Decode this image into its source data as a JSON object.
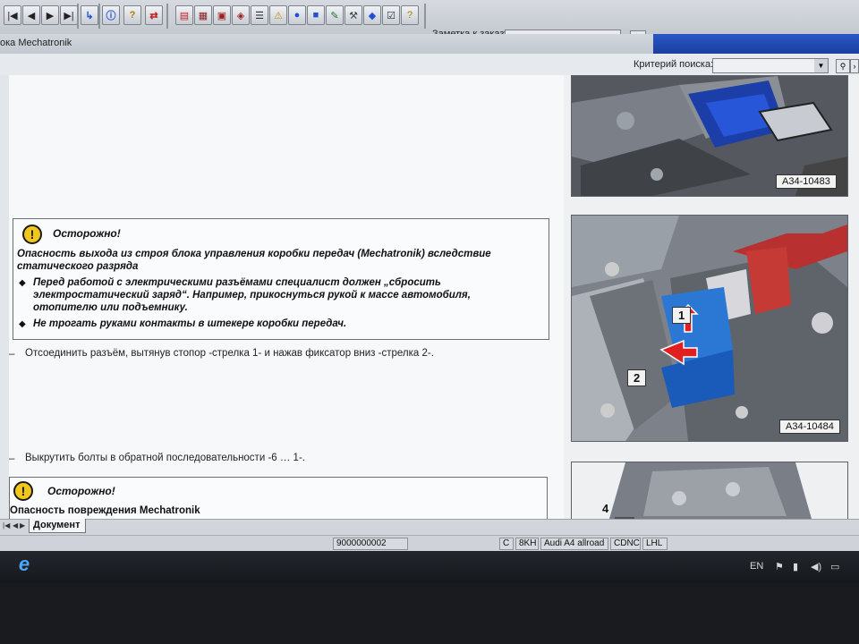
{
  "toolbar": {
    "nav_buttons": [
      "|◀",
      "◀",
      "▶",
      "▶|"
    ],
    "tool_icons": [
      "bookmark-icon",
      "info-icon",
      "help-icon",
      "exchange-icon",
      "print-icon",
      "calc-icon",
      "book-icon",
      "list-icon",
      "warning-icon",
      "globe-icon",
      "save-icon",
      "edit-icon",
      "wrench-icon",
      "car-icon",
      "check-icon",
      "help2-icon"
    ],
    "order_label": "Заметка к заказу:",
    "order_value": ""
  },
  "window": {
    "title": "ока Mechatronik"
  },
  "search": {
    "label": "Критерий поиска:",
    "value": ""
  },
  "document": {
    "warning1": {
      "title": "Осторожно!",
      "text": "Опасность выхода из строя блока управления коробки передач (Mechatronik) вследствие статического разряда",
      "bullets": [
        "Перед работой с электрическими разъёмами специалист должен „сбросить электростатический заряд“. Например, прикоснуться рукой к массе автомобиля, отопителю или подъемнику.",
        "Не трогать руками контакты в штекере коробки передач."
      ]
    },
    "step1": "Отсоединить разъём, вытянув стопор -стрелка 1- и нажав фиксатор вниз -стрелка 2-.",
    "step2": "Выкрутить болты в обратной последовательности -6 … 1-.",
    "warning2": {
      "title": "Осторожно!",
      "text": "Опасность повреждения Mechatronik"
    }
  },
  "figures": [
    {
      "label": "A34-10483"
    },
    {
      "label": "A34-10484",
      "arrow1": "1",
      "arrow2": "2"
    },
    {
      "callout": "4"
    }
  ],
  "tabs": {
    "active": "Документ"
  },
  "status": {
    "doc_number": "9000000002",
    "fields": [
      "C",
      "8KH",
      "Audi A4 allroad",
      "CDNC",
      "LHL"
    ]
  },
  "taskbar": {
    "ie_icon": "e",
    "language": "EN"
  }
}
